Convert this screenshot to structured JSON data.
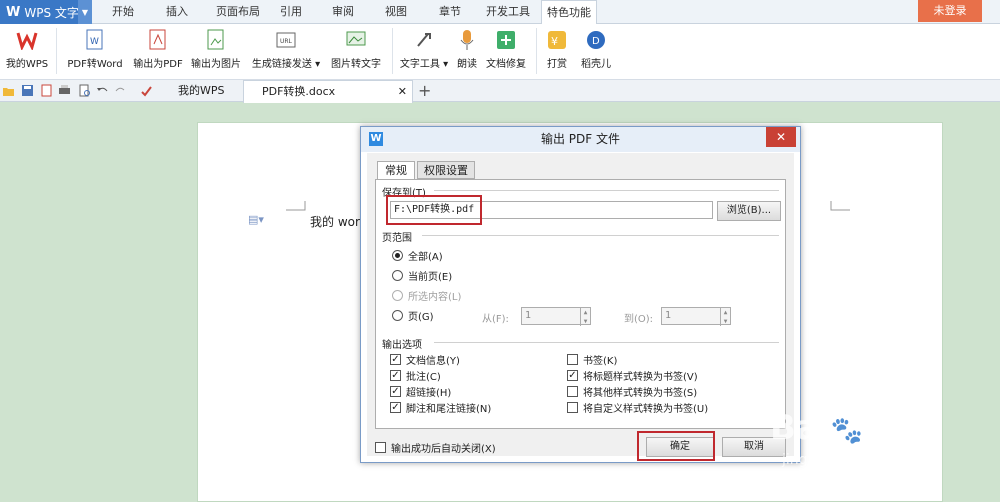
{
  "app": {
    "logo": "W",
    "name": "WPS 文字"
  },
  "menu_tabs": [
    {
      "label": "开始"
    },
    {
      "label": "插入"
    },
    {
      "label": "页面布局"
    },
    {
      "label": "引用"
    },
    {
      "label": "审阅"
    },
    {
      "label": "视图"
    },
    {
      "label": "章节"
    },
    {
      "label": "开发工具"
    },
    {
      "label": "特色功能"
    }
  ],
  "login_label": "未登录",
  "ribbon": [
    {
      "label": "我的WPS",
      "icon": "wps-logo-icon"
    },
    {
      "label": "PDF转Word",
      "icon": "pdf-to-word-icon"
    },
    {
      "label": "输出为PDF",
      "icon": "export-pdf-icon"
    },
    {
      "label": "输出为图片",
      "icon": "export-image-icon"
    },
    {
      "label": "生成链接发送",
      "icon": "share-link-icon"
    },
    {
      "label": "图片转文字",
      "icon": "image-to-text-icon"
    },
    {
      "label": "文字工具",
      "icon": "text-tools-icon"
    },
    {
      "label": "朗读",
      "icon": "microphone-icon"
    },
    {
      "label": "文档修复",
      "icon": "doc-repair-icon"
    },
    {
      "label": "打赏",
      "icon": "reward-icon"
    },
    {
      "label": "稻壳儿",
      "icon": "docer-icon"
    }
  ],
  "doc_tabs": [
    {
      "label": "我的WPS"
    },
    {
      "label": "PDF转换.docx"
    }
  ],
  "doc_text": "我的 wor",
  "dialog": {
    "title": "输出 PDF 文件",
    "tabs": [
      {
        "label": "常规"
      },
      {
        "label": "权限设置"
      }
    ],
    "save_to_label": "保存到(T)",
    "save_path": "F:\\PDF转换.pdf",
    "browse_label": "浏览(B)...",
    "range_label": "页范围",
    "range_options": [
      {
        "label": "全部(A)",
        "selected": true,
        "disabled": false
      },
      {
        "label": "当前页(E)",
        "selected": false,
        "disabled": false
      },
      {
        "label": "所选内容(L)",
        "selected": false,
        "disabled": true
      },
      {
        "label": "页(G)",
        "selected": false,
        "disabled": false
      }
    ],
    "from_label": "从(F):",
    "from_value": "1",
    "to_label": "到(O):",
    "to_value": "1",
    "output_label": "输出选项",
    "left_options": [
      {
        "label": "文档信息(Y)",
        "checked": true
      },
      {
        "label": "批注(C)",
        "checked": true
      },
      {
        "label": "超链接(H)",
        "checked": true
      },
      {
        "label": "脚注和尾注链接(N)",
        "checked": true
      }
    ],
    "right_options": [
      {
        "label": "书签(K)",
        "checked": false
      },
      {
        "label": "将标题样式转换为书签(V)",
        "checked": true
      },
      {
        "label": "将其他样式转换为书签(S)",
        "checked": false
      },
      {
        "label": "将自定义样式转换为书签(U)",
        "checked": false
      }
    ],
    "auto_close_label": "输出成功后自动关闭(X)",
    "ok_label": "确定",
    "cancel_label": "取消"
  },
  "watermark": {
    "brand": "Bai",
    "brand2": "经验",
    "url": "jingyan.baidu.com"
  },
  "colors": {
    "accent": "#3a78c6",
    "highlight": "#c0282e",
    "login": "#e8704a",
    "close": "#c94135"
  }
}
